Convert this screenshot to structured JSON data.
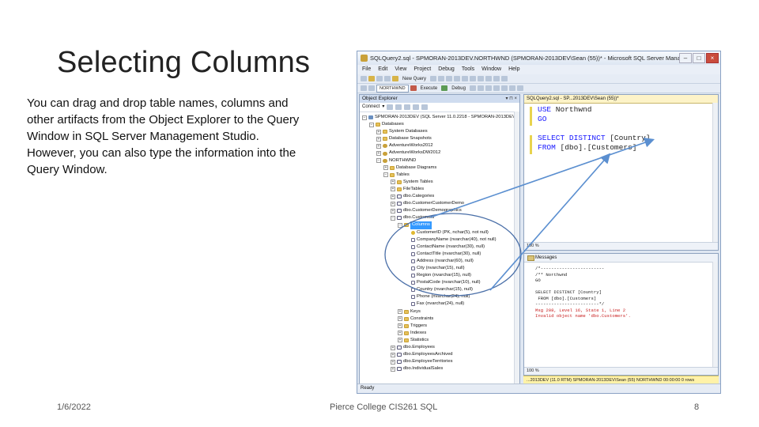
{
  "slide": {
    "title": "Selecting Columns",
    "body": "You can drag and drop table names, columns and other artifacts from the Object Explorer to the Query Window in SQL Server Management Studio. However, you can also type the information into the Query Window.",
    "footer_date": "1/6/2022",
    "footer_center": "Pierce College CIS261 SQL",
    "footer_page": "8"
  },
  "window": {
    "title": "SQLQuery2.sql - SPMORAN-2013DEV.NORTHWND (SPMORAN-2013DEV\\Sean (55))* - Microsoft SQL Server Manage...",
    "menu": [
      "File",
      "Edit",
      "View",
      "Project",
      "Debug",
      "Tools",
      "Window",
      "Help"
    ],
    "toolbar": {
      "new_query": "New Query",
      "database": "NORTHWND",
      "execute": "Execute",
      "debug": "Debug"
    },
    "object_explorer": {
      "title": "Object Explorer",
      "connect": "Connect",
      "tree": [
        {
          "level": 0,
          "text": "SPMORAN-2013DEV (SQL Server 11.0.2218 - SPMORAN-2013DEV",
          "icon": "server",
          "toggle": "−"
        },
        {
          "level": 1,
          "text": "Databases",
          "icon": "folder",
          "toggle": "−"
        },
        {
          "level": 2,
          "text": "System Databases",
          "icon": "folder",
          "toggle": "+"
        },
        {
          "level": 2,
          "text": "Database Snapshots",
          "icon": "folder",
          "toggle": "+"
        },
        {
          "level": 2,
          "text": "AdventureWorks2012",
          "icon": "db",
          "toggle": "+"
        },
        {
          "level": 2,
          "text": "AdventureWorksDW2012",
          "icon": "db",
          "toggle": "+"
        },
        {
          "level": 2,
          "text": "NORTHWND",
          "icon": "db",
          "toggle": "−"
        },
        {
          "level": 3,
          "text": "Database Diagrams",
          "icon": "folder",
          "toggle": "+"
        },
        {
          "level": 3,
          "text": "Tables",
          "icon": "folder",
          "toggle": "−"
        },
        {
          "level": 4,
          "text": "System Tables",
          "icon": "folder",
          "toggle": "+"
        },
        {
          "level": 4,
          "text": "FileTables",
          "icon": "folder",
          "toggle": "+"
        },
        {
          "level": 4,
          "text": "dbo.Categories",
          "icon": "table",
          "toggle": "+"
        },
        {
          "level": 4,
          "text": "dbo.CustomerCustomerDemo",
          "icon": "table",
          "toggle": "+"
        },
        {
          "level": 4,
          "text": "dbo.CustomerDemographics",
          "icon": "table",
          "toggle": "+"
        },
        {
          "level": 4,
          "text": "dbo.Customers",
          "icon": "table",
          "toggle": "−"
        },
        {
          "level": 5,
          "text": "Columns",
          "icon": "folder",
          "toggle": "−",
          "selected": true
        },
        {
          "level": 6,
          "text": "CustomerID (PK, nchar(5), not null)",
          "icon": "key",
          "toggle": ""
        },
        {
          "level": 6,
          "text": "CompanyName (nvarchar(40), not null)",
          "icon": "col",
          "toggle": ""
        },
        {
          "level": 6,
          "text": "ContactName (nvarchar(30), null)",
          "icon": "col",
          "toggle": ""
        },
        {
          "level": 6,
          "text": "ContactTitle (nvarchar(30), null)",
          "icon": "col",
          "toggle": ""
        },
        {
          "level": 6,
          "text": "Address (nvarchar(60), null)",
          "icon": "col",
          "toggle": ""
        },
        {
          "level": 6,
          "text": "City (nvarchar(15), null)",
          "icon": "col",
          "toggle": ""
        },
        {
          "level": 6,
          "text": "Region (nvarchar(15), null)",
          "icon": "col",
          "toggle": ""
        },
        {
          "level": 6,
          "text": "PostalCode (nvarchar(10), null)",
          "icon": "col",
          "toggle": ""
        },
        {
          "level": 6,
          "text": "Country (nvarchar(15), null)",
          "icon": "col",
          "toggle": ""
        },
        {
          "level": 6,
          "text": "Phone (nvarchar(24), null)",
          "icon": "col",
          "toggle": ""
        },
        {
          "level": 6,
          "text": "Fax (nvarchar(24), null)",
          "icon": "col",
          "toggle": ""
        },
        {
          "level": 5,
          "text": "Keys",
          "icon": "folder",
          "toggle": "+"
        },
        {
          "level": 5,
          "text": "Constraints",
          "icon": "folder",
          "toggle": "+"
        },
        {
          "level": 5,
          "text": "Triggers",
          "icon": "folder",
          "toggle": "+"
        },
        {
          "level": 5,
          "text": "Indexes",
          "icon": "folder",
          "toggle": "+"
        },
        {
          "level": 5,
          "text": "Statistics",
          "icon": "folder",
          "toggle": "+"
        },
        {
          "level": 4,
          "text": "dbo.Employees",
          "icon": "table",
          "toggle": "+"
        },
        {
          "level": 4,
          "text": "dbo.EmployeesArchived",
          "icon": "table",
          "toggle": "+"
        },
        {
          "level": 4,
          "text": "dbo.EmployeeTerritories",
          "icon": "table",
          "toggle": "+"
        },
        {
          "level": 4,
          "text": "dbo.IndividualSales",
          "icon": "table",
          "toggle": "+"
        }
      ]
    },
    "editor": {
      "tab": "SQLQuery2.sql - SP...2013DEV\\Sean (55))*",
      "line1_kw": "USE",
      "line1_rest": " Northwnd",
      "line2_kw": "GO",
      "line3_kw": "SELECT DISTINCT",
      "line3_rest": " [Country]",
      "line4_kw": "FROM",
      "line4_rest": " [dbo].[Customers]",
      "zoom": "100 %"
    },
    "messages": {
      "tab": "Messages",
      "lines": [
        "/*------------------------",
        "/** Northwnd",
        "GO",
        "",
        "SELECT DISTINCT [Country]",
        " FROM [dbo].[Customers]",
        "------------------------*/"
      ],
      "error1": "Msg 208, Level 16, State 1, Line 2",
      "error2": "Invalid object name 'dbo.Customers'.",
      "zoom": "100 %"
    },
    "status": "...2013DEV (11.0 RTM)   SPMORAN-2013DEV\\Sean (55)   NORTHWND   00:00:00   0 rows",
    "ready": "Ready"
  }
}
